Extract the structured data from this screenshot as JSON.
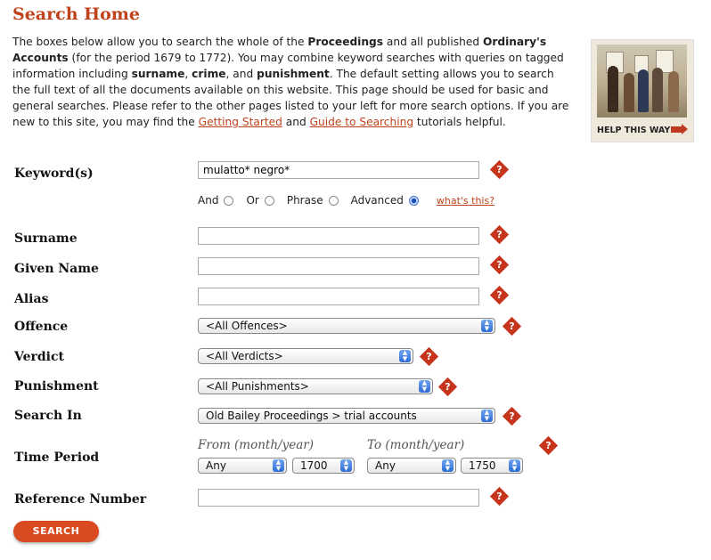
{
  "page": {
    "title": "Search Home"
  },
  "intro": {
    "p1": "The boxes below allow you to search the whole of the ",
    "b1": "Proceedings",
    "p2": " and all published ",
    "b2": "Ordinary's Accounts",
    "p3": " (for the period 1679 to 1772). You may combine keyword searches with queries on tagged information including ",
    "b3": "surname",
    "p4": ", ",
    "b4": "crime",
    "p5": ", and ",
    "b5": "punishment",
    "p6": ". The default setting allows you to search the full text of all the documents available on this website. This page should be used for basic and general searches. Please refer to the other pages listed to your left for more search options. If you are new to this site, you may find the ",
    "link1": "Getting Started",
    "p7": " and ",
    "link2": "Guide to Searching",
    "p8": " tutorials helpful."
  },
  "help": {
    "label": "HELP THIS WAY",
    "icon": "arrow-right-icon"
  },
  "form": {
    "keyword": {
      "label": "Keyword(s)",
      "value": "mulatto* negro*"
    },
    "match": {
      "options": [
        "And",
        "Or",
        "Phrase",
        "Advanced"
      ],
      "selected": "Advanced",
      "whats_this": "what's this?"
    },
    "surname": {
      "label": "Surname",
      "value": ""
    },
    "given_name": {
      "label": "Given Name",
      "value": ""
    },
    "alias": {
      "label": "Alias",
      "value": ""
    },
    "offence": {
      "label": "Offence",
      "value": "<All Offences>"
    },
    "verdict": {
      "label": "Verdict",
      "value": "<All Verdicts>"
    },
    "punishment": {
      "label": "Punishment",
      "value": "<All Punishments>"
    },
    "search_in": {
      "label": "Search In",
      "value": "Old Bailey Proceedings > trial accounts"
    },
    "time_period": {
      "label": "Time Period",
      "from_label": "From (month/year)",
      "to_label": "To (month/year)",
      "from_month": "Any",
      "from_year": "1700",
      "to_month": "Any",
      "to_year": "1750"
    },
    "reference": {
      "label": "Reference Number",
      "value": ""
    },
    "help_glyph": "?",
    "submit_label": "SEARCH"
  },
  "colors": {
    "accent": "#c0421c",
    "help_icon": "#c6341c",
    "button": "#d94a20"
  }
}
